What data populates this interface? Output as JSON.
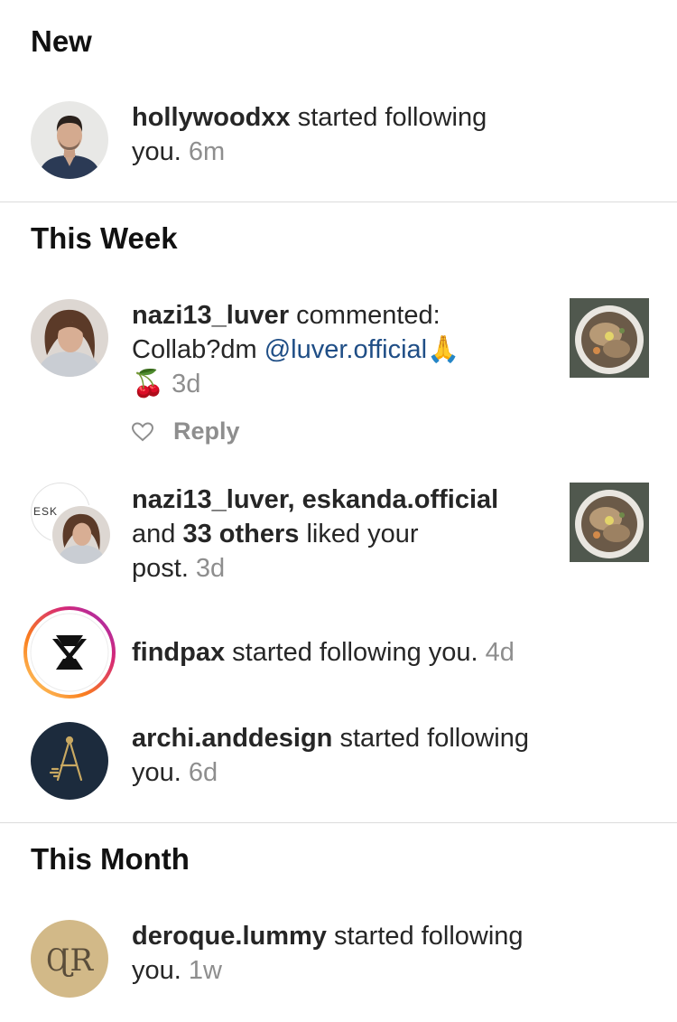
{
  "sections": {
    "new": "New",
    "week": "This Week",
    "month": "This Month"
  },
  "n1": {
    "user": "hollywoodxx",
    "line1": " started following",
    "line2": "you.",
    "time": " 6m"
  },
  "n2": {
    "user": "nazi13_luver",
    "text1": " commented:",
    "text2": "Collab?dm ",
    "mention": "@luver.official",
    "emoji1": "🙏",
    "emoji2": "🍒",
    "time": " 3d",
    "reply": "Reply"
  },
  "n3": {
    "users": "nazi13_luver, eskanda.official",
    "and": "and ",
    "others": "33 others",
    "liked": " liked your",
    "post": "post.",
    "time": " 3d",
    "avatar_back_text": "ESK"
  },
  "n4": {
    "user": "findpax",
    "text": " started following you.",
    "time": " 4d"
  },
  "n5": {
    "user": "archi.anddesign",
    "line1": " started following",
    "line2": "you.",
    "time": " 6d",
    "logo_letter": "A"
  },
  "n6": {
    "user": "deroque.lummy",
    "line1": " started following",
    "line2": "you.",
    "time": " 1w",
    "logo_letters": "ɊR"
  },
  "colors": {
    "mention": "#1f4e86",
    "muted": "#8e8e8e",
    "divider": "#dbdbdb",
    "archi_bg": "#1c2b3d",
    "archi_gold": "#c9a962",
    "deroque_bg": "#d2b988",
    "story_ring": [
      "#feda75",
      "#fa7e1e",
      "#d62976",
      "#962fbf"
    ]
  }
}
